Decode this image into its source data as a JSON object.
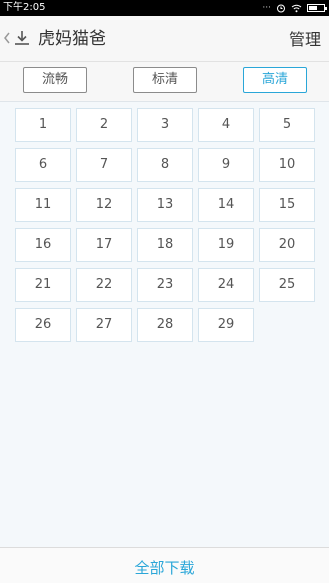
{
  "status_bar": {
    "time": "下午2:05",
    "battery_level": 0.6
  },
  "header": {
    "back_icon": "back-chevron-icon",
    "download_icon": "download-icon",
    "title": "虎妈猫爸",
    "manage_label": "管理"
  },
  "quality": {
    "options": [
      "流畅",
      "标清",
      "高清"
    ],
    "selected": "高清",
    "accent_color": "#2aa6d8"
  },
  "episodes": [
    "1",
    "2",
    "3",
    "4",
    "5",
    "6",
    "7",
    "8",
    "9",
    "10",
    "11",
    "12",
    "13",
    "14",
    "15",
    "16",
    "17",
    "18",
    "19",
    "20",
    "21",
    "22",
    "23",
    "24",
    "25",
    "26",
    "27",
    "28",
    "29"
  ],
  "footer": {
    "download_all_label": "全部下载"
  }
}
